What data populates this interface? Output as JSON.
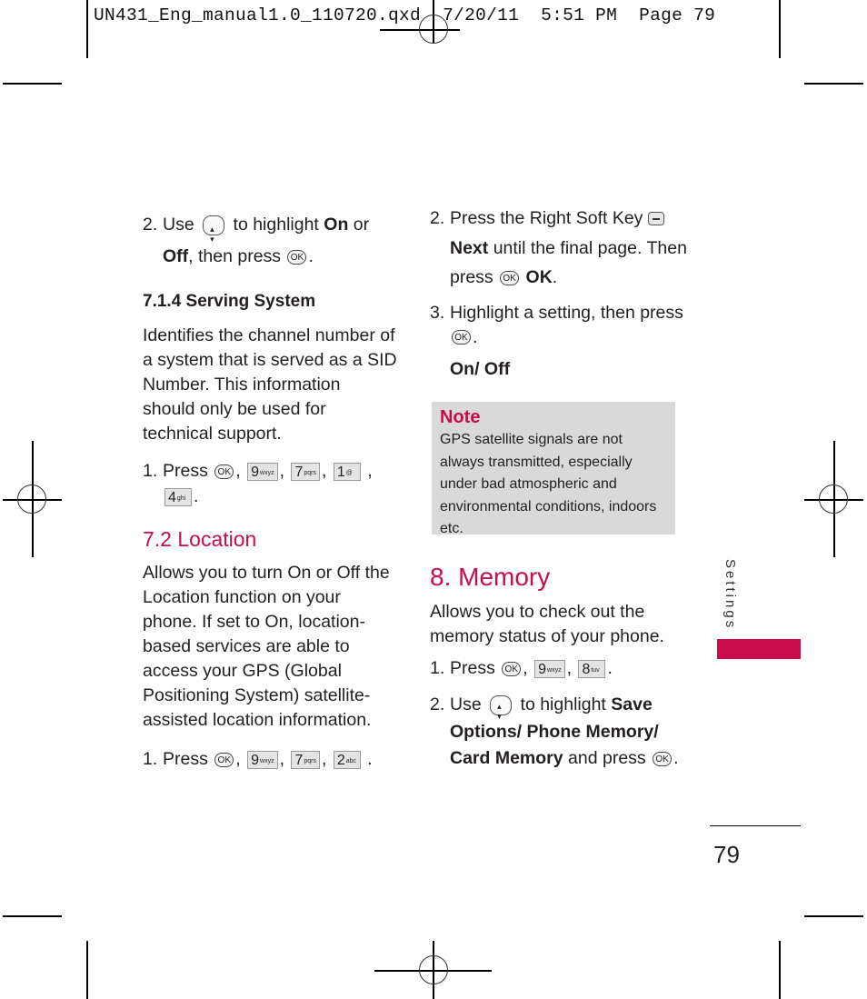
{
  "slug": {
    "filename": "UN431_Eng_manual1.0_110720.qxd",
    "date": "7/20/11",
    "time": "5:51 PM",
    "page_label": "Page 79"
  },
  "colors": {
    "accent": "#c80c4c",
    "note_bg": "#d9d9d9"
  },
  "left_column": {
    "step2": {
      "num": "2.",
      "pre": "Use",
      "icon": "nav-updown-key-icon",
      "mid": "to highlight",
      "bold1": "On",
      "or": "or",
      "bold2": "Off",
      "post": ", then press",
      "end": "."
    },
    "serving_system": {
      "heading": "7.1.4 Serving System",
      "body": "Identifies the channel number of a system that is served as a SID Number. This information should only be used for technical support.",
      "step1": {
        "num": "1.",
        "label": "Press",
        "keys": [
          {
            "digit": "9",
            "letters": "wxyz"
          },
          {
            "digit": "7",
            "letters": "pqrs"
          },
          {
            "digit": "1",
            "letters": "@"
          },
          {
            "digit": "4",
            "letters": "ghi"
          }
        ]
      }
    },
    "location": {
      "heading": "7.2 Location",
      "body": "Allows you to turn On or Off the Location function on your phone. If set to On, location-based services are able to access your GPS (Global Positioning System) satellite-assisted location information.",
      "step1": {
        "num": "1.",
        "label": "Press",
        "keys": [
          {
            "digit": "9",
            "letters": "wxyz"
          },
          {
            "digit": "7",
            "letters": "pqrs"
          },
          {
            "digit": "2",
            "letters": "abc"
          }
        ]
      }
    }
  },
  "right_column": {
    "step2": {
      "num": "2.",
      "pre": "Press the Right Soft Key",
      "bold_next": "Next",
      "mid": "until the final page. Then press",
      "bold_ok": "OK",
      "end": "."
    },
    "step3": {
      "num": "3.",
      "text": "Highlight a setting, then press",
      "end": ".",
      "options": "On/ Off"
    },
    "note": {
      "title": "Note",
      "body": "GPS satellite signals are not always transmitted, especially under bad atmospheric and environmental conditions, indoors etc."
    },
    "memory": {
      "heading": "8. Memory",
      "body": "Allows you to check out the memory status of your phone.",
      "step1": {
        "num": "1.",
        "label": "Press",
        "keys": [
          {
            "digit": "9",
            "letters": "wxyz"
          },
          {
            "digit": "8",
            "letters": "tuv"
          }
        ]
      },
      "step2": {
        "num": "2.",
        "pre": "Use",
        "mid": "to highlight",
        "bold": "Save Options/ Phone Memory/ Card Memory",
        "post": "and press",
        "end": "."
      }
    }
  },
  "ok_key_label": "OK",
  "side_tab": {
    "label": "Settings"
  },
  "page_number": "79"
}
